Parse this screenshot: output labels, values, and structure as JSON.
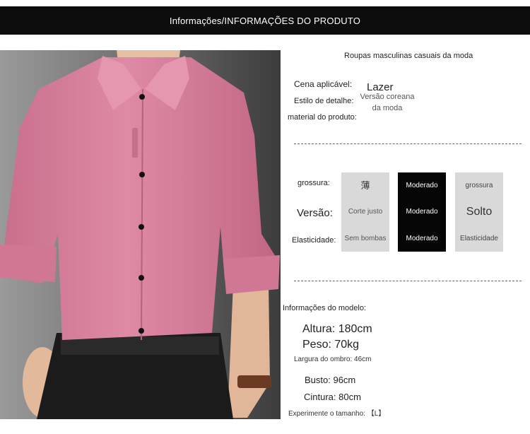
{
  "header": {
    "title": "Informações/INFORMAÇÕES DO PRODUTO"
  },
  "product": {
    "subtitle": "Roupas masculinas casuais da moda",
    "scene_label": "Cena aplicável:",
    "scene_value": "Lazer",
    "style_label": "Estilo de detalhe:",
    "style_value": "Versão coreana da moda",
    "material_label": "material do produto:"
  },
  "attributes": {
    "row_labels": [
      "grossura:",
      "Versão:",
      "Elasticidade:"
    ],
    "columns": [
      {
        "cells": [
          "薄",
          "Corte justo",
          "Sem bombas"
        ]
      },
      {
        "cells": [
          "Moderado",
          "Moderado",
          "Moderado"
        ]
      },
      {
        "cells": [
          "grossura",
          "Solto",
          "Elasticidade"
        ]
      }
    ]
  },
  "model": {
    "title": "Informações do modelo:",
    "height": "Altura: 180cm",
    "weight": "Peso: 70kg",
    "shoulder": "Largura do ombro: 46cm",
    "bust": "Busto: 96cm",
    "waist": "Cintura: 80cm",
    "size": "Experimente o tamanho: 【L】"
  },
  "photo": {
    "shirt_color": "#d67f9b",
    "background_color": "#7a7a7a",
    "pants_color": "#1b1b1b",
    "skin_color": "#e8c3a8"
  }
}
